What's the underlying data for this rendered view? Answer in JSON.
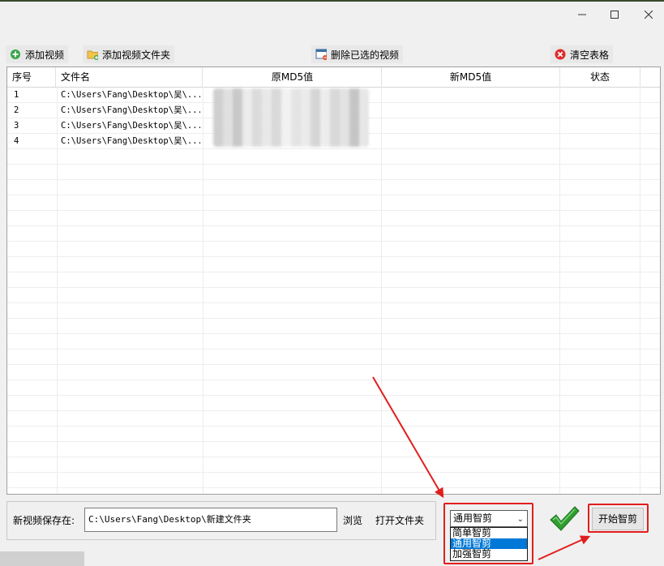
{
  "window": {
    "minimize_icon": "minimize-icon",
    "maximize_icon": "maximize-icon",
    "close_icon": "close-icon"
  },
  "toolbar": {
    "add_video": "添加视频",
    "add_video_folder": "添加视频文件夹",
    "delete_selected": "删除已选的视频",
    "clear_table": "清空表格"
  },
  "table": {
    "columns": [
      "序号",
      "文件名",
      "原MD5值",
      "新MD5值",
      "状态"
    ],
    "rows": [
      {
        "index": "1",
        "filename": "C:\\Users\\Fang\\Desktop\\吴\\...",
        "old_md5": "",
        "new_md5": "",
        "status": ""
      },
      {
        "index": "2",
        "filename": "C:\\Users\\Fang\\Desktop\\吴\\...",
        "old_md5": "",
        "new_md5": "",
        "status": ""
      },
      {
        "index": "3",
        "filename": "C:\\Users\\Fang\\Desktop\\吴\\...",
        "old_md5": "",
        "new_md5": "",
        "status": ""
      },
      {
        "index": "4",
        "filename": "C:\\Users\\Fang\\Desktop\\吴\\...",
        "old_md5": "",
        "new_md5": "",
        "status": ""
      }
    ]
  },
  "bottom": {
    "save_label": "新视频保存在:",
    "save_path": "C:\\Users\\Fang\\Desktop\\新建文件夹",
    "browse": "浏览",
    "open_folder": "打开文件夹",
    "mode_selected": "通用智剪",
    "mode_options": [
      "简单智剪",
      "通用智剪",
      "加强智剪"
    ],
    "start": "开始智剪"
  },
  "colors": {
    "highlight_red": "#e21d1d",
    "selection_blue": "#0078d7",
    "check_green": "#2e9e2e"
  }
}
